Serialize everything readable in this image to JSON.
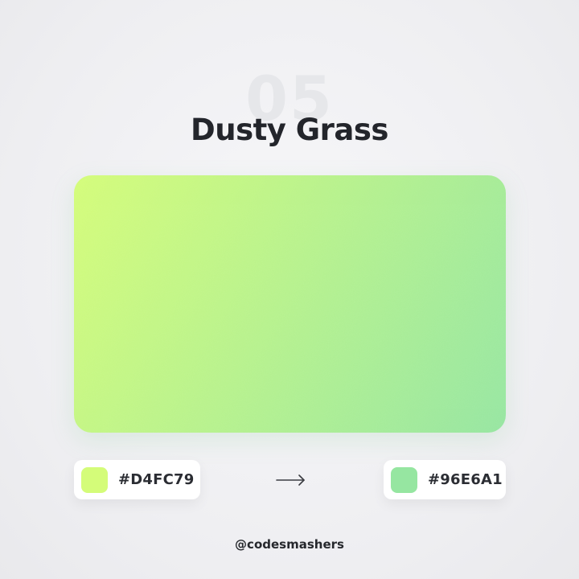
{
  "index_number": "05",
  "title": "Dusty Grass",
  "gradient": {
    "start_color": "#D4FC79",
    "end_color": "#96E6A1",
    "start_label": "#D4FC79",
    "end_label": "#96E6A1"
  },
  "arrow_icon": "arrow-right-icon",
  "handle": "@codesmashers"
}
